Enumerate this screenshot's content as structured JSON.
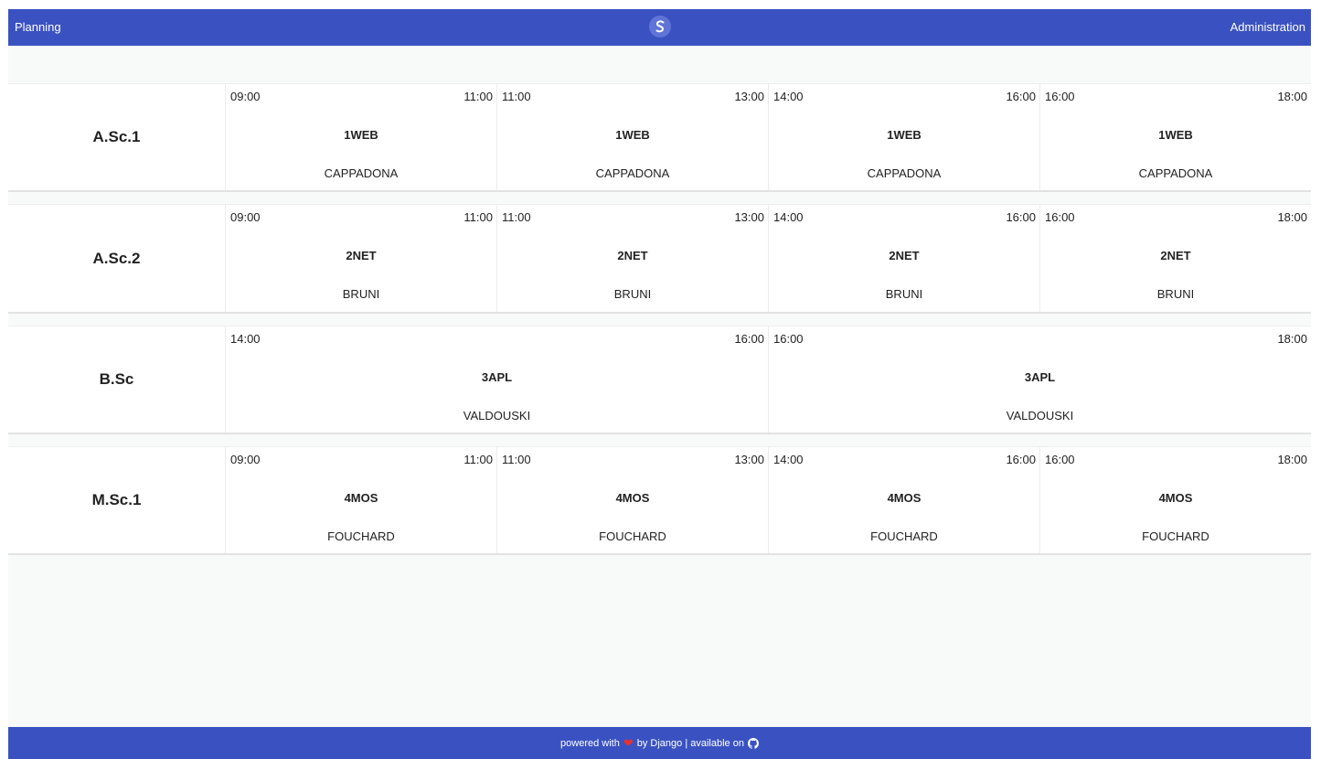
{
  "navbar": {
    "left_label": "Planning",
    "right_label": "Administration",
    "logo_icon": "logo-icon"
  },
  "rows": [
    {
      "room": "A.Sc.1",
      "slots": [
        {
          "start": "09:00",
          "end": "11:00",
          "course": "1WEB",
          "teacher": "CAPPADONA"
        },
        {
          "start": "11:00",
          "end": "13:00",
          "course": "1WEB",
          "teacher": "CAPPADONA"
        },
        {
          "start": "14:00",
          "end": "16:00",
          "course": "1WEB",
          "teacher": "CAPPADONA"
        },
        {
          "start": "16:00",
          "end": "18:00",
          "course": "1WEB",
          "teacher": "CAPPADONA"
        }
      ]
    },
    {
      "room": "A.Sc.2",
      "slots": [
        {
          "start": "09:00",
          "end": "11:00",
          "course": "2NET",
          "teacher": "BRUNI"
        },
        {
          "start": "11:00",
          "end": "13:00",
          "course": "2NET",
          "teacher": "BRUNI"
        },
        {
          "start": "14:00",
          "end": "16:00",
          "course": "2NET",
          "teacher": "BRUNI"
        },
        {
          "start": "16:00",
          "end": "18:00",
          "course": "2NET",
          "teacher": "BRUNI"
        }
      ]
    },
    {
      "room": "B.Sc",
      "slots": [
        {
          "start": "14:00",
          "end": "16:00",
          "course": "3APL",
          "teacher": "VALDOUSKI"
        },
        {
          "start": "16:00",
          "end": "18:00",
          "course": "3APL",
          "teacher": "VALDOUSKI"
        }
      ]
    },
    {
      "room": "M.Sc.1",
      "slots": [
        {
          "start": "09:00",
          "end": "11:00",
          "course": "4MOS",
          "teacher": "FOUCHARD"
        },
        {
          "start": "11:00",
          "end": "13:00",
          "course": "4MOS",
          "teacher": "FOUCHARD"
        },
        {
          "start": "14:00",
          "end": "16:00",
          "course": "4MOS",
          "teacher": "FOUCHARD"
        },
        {
          "start": "16:00",
          "end": "18:00",
          "course": "4MOS",
          "teacher": "FOUCHARD"
        }
      ]
    }
  ],
  "footer": {
    "text_before": "powered with",
    "text_after": "by Django | available on",
    "heart_icon": "heart-icon",
    "github_icon": "github-icon",
    "heart_color": "#e5322d"
  },
  "colors": {
    "brand": "#3a52c1",
    "background": "#f8f9f9"
  }
}
